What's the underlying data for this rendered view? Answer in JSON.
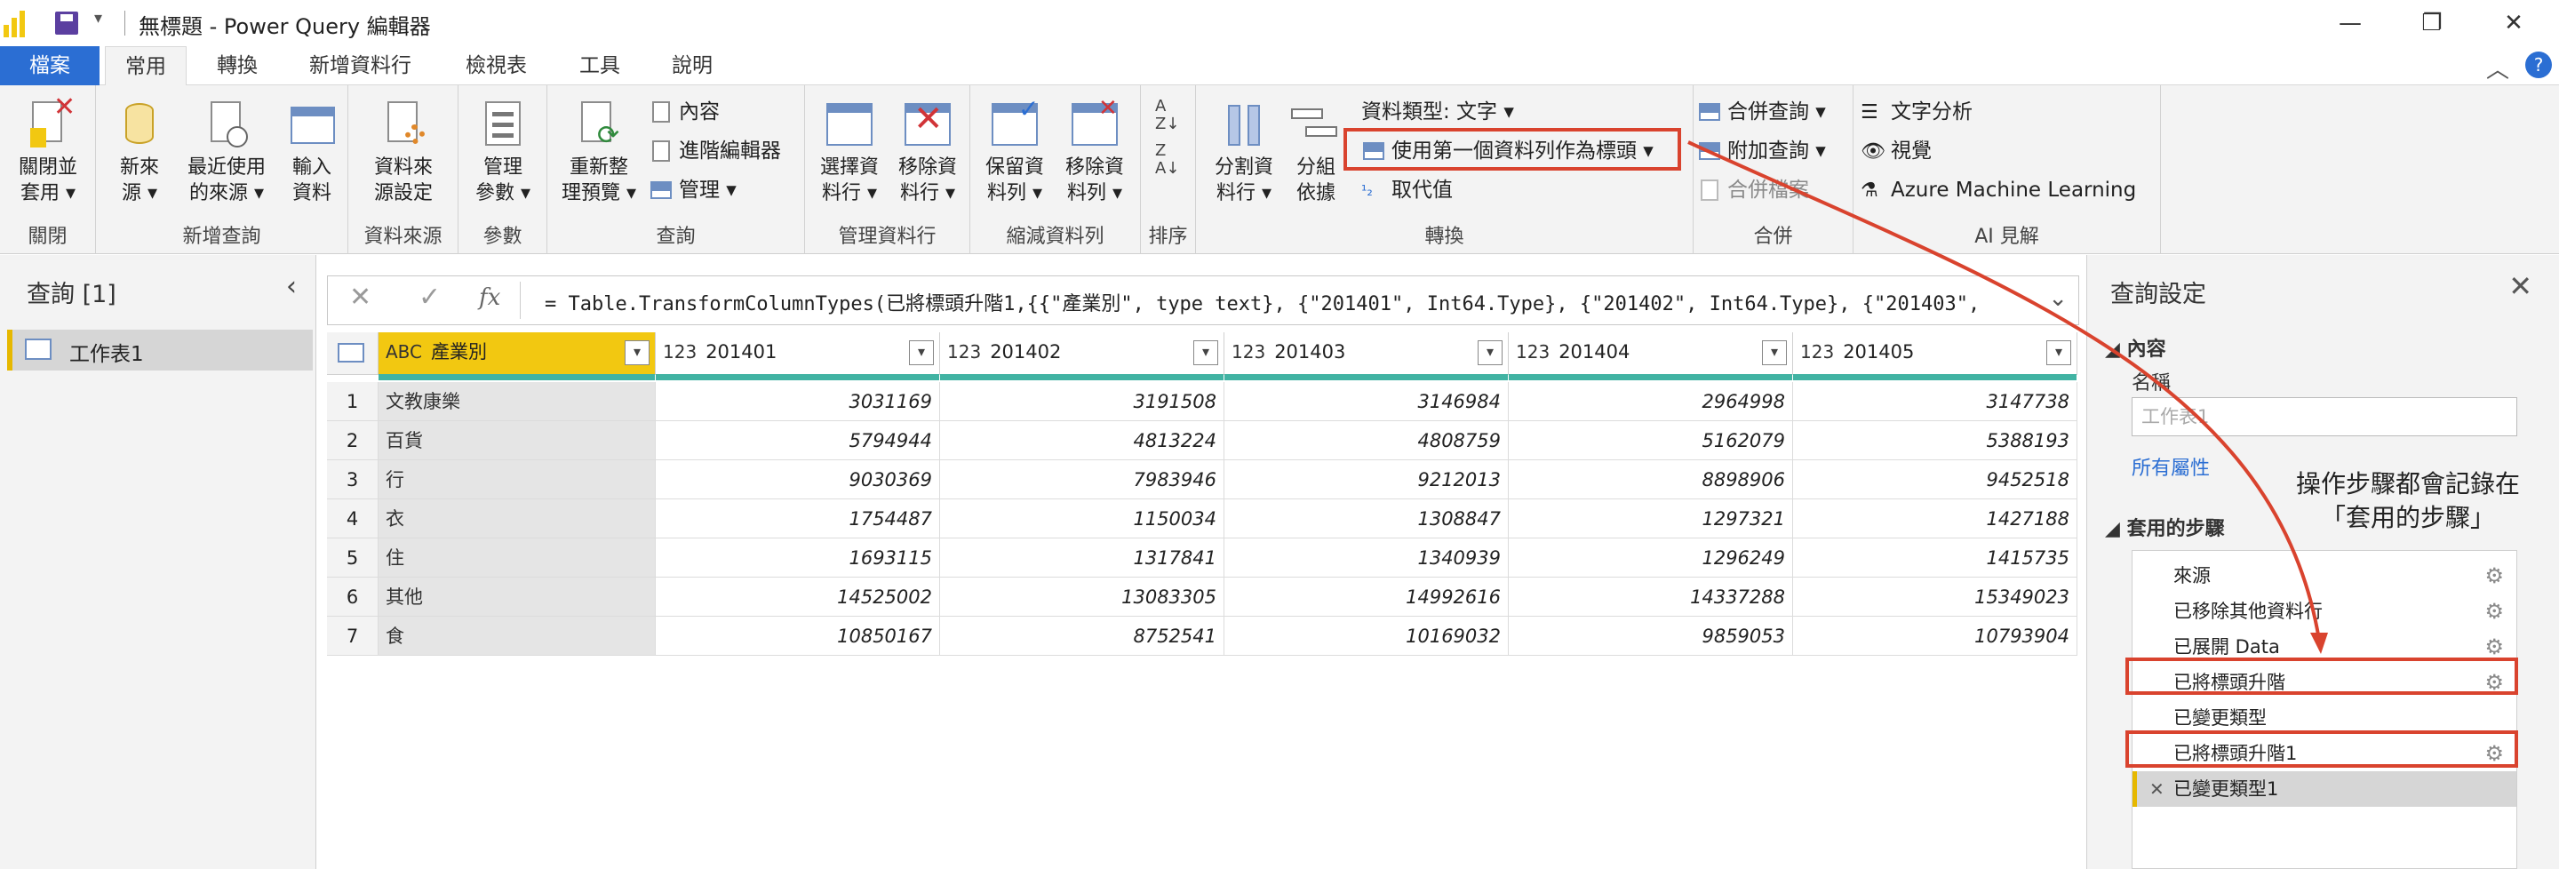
{
  "window": {
    "title": "無標題 - Power Query 編輯器",
    "minimize": "—",
    "restore": "❐",
    "close": "✕"
  },
  "menu": {
    "file": "檔案",
    "tabs": [
      "常用",
      "轉換",
      "新增資料行",
      "檢視表",
      "工具",
      "說明"
    ],
    "active_tab": "常用"
  },
  "ribbon": {
    "groups": {
      "close": "關閉",
      "new_query": "新增查詢",
      "data_source": "資料來源",
      "params": "參數",
      "query": "查詢",
      "manage_cols": "管理資料行",
      "reduce_rows": "縮減資料列",
      "sort": "排序",
      "transform": "轉換",
      "combine": "合併",
      "ai": "AI 見解"
    },
    "buttons": {
      "close_apply": [
        "關閉並",
        "套用 ▾"
      ],
      "new_source": [
        "新來",
        "源 ▾"
      ],
      "recent_sources": [
        "最近使用",
        "的來源 ▾"
      ],
      "enter_data": [
        "輸入",
        "資料"
      ],
      "data_source_settings": [
        "資料來",
        "源設定"
      ],
      "manage_params": [
        "管理",
        "參數 ▾"
      ],
      "refresh_preview": [
        "重新整",
        "理預覽 ▾"
      ],
      "properties": "內容",
      "advanced_editor": "進階編輯器",
      "manage": "管理 ▾",
      "choose_columns": [
        "選擇資",
        "料行 ▾"
      ],
      "remove_columns": [
        "移除資",
        "料行 ▾"
      ],
      "keep_rows": [
        "保留資",
        "料列 ▾"
      ],
      "remove_rows": [
        "移除資",
        "料列 ▾"
      ],
      "split_column": [
        "分割資",
        "料行 ▾"
      ],
      "group_by": [
        "分組",
        "依據"
      ],
      "data_type": "資料類型: 文字 ▾",
      "use_first_row_headers": "使用第一個資料列作為標頭 ▾",
      "replace_values": "取代值",
      "merge_queries": "合併查詢 ▾",
      "append_queries": "附加查詢 ▾",
      "combine_files": "合併檔案",
      "text_analytics": "文字分析",
      "vision": "視覺",
      "azure_ml": "Azure Machine Learning"
    }
  },
  "queries_pane": {
    "header": "查詢 [1]",
    "collapse": "‹",
    "items": [
      "工作表1"
    ]
  },
  "formula_bar": {
    "cancel": "✕",
    "commit": "✓",
    "fx": "fx",
    "formula": "= Table.TransformColumnTypes(已將標頭升階1,{{\"產業別\", type text}, {\"201401\", Int64.Type}, {\"201402\", Int64.Type}, {\"201403\",",
    "expand": "⌄"
  },
  "table": {
    "columns": [
      {
        "type": "ABC",
        "name": "產業別"
      },
      {
        "type": "123",
        "name": "201401"
      },
      {
        "type": "123",
        "name": "201402"
      },
      {
        "type": "123",
        "name": "201403"
      },
      {
        "type": "123",
        "name": "201404"
      },
      {
        "type": "123",
        "name": "201405"
      }
    ],
    "rows": [
      {
        "n": "1",
        "cat": "文教康樂",
        "v": [
          "3031169",
          "3191508",
          "3146984",
          "2964998",
          "3147738"
        ]
      },
      {
        "n": "2",
        "cat": "百貨",
        "v": [
          "5794944",
          "4813224",
          "4808759",
          "5162079",
          "5388193"
        ]
      },
      {
        "n": "3",
        "cat": "行",
        "v": [
          "9030369",
          "7983946",
          "9212013",
          "8898906",
          "9452518"
        ]
      },
      {
        "n": "4",
        "cat": "衣",
        "v": [
          "1754487",
          "1150034",
          "1308847",
          "1297321",
          "1427188"
        ]
      },
      {
        "n": "5",
        "cat": "住",
        "v": [
          "1693115",
          "1317841",
          "1340939",
          "1296249",
          "1415735"
        ]
      },
      {
        "n": "6",
        "cat": "其他",
        "v": [
          "14525002",
          "13083305",
          "14992616",
          "14337288",
          "15349023"
        ]
      },
      {
        "n": "7",
        "cat": "食",
        "v": [
          "10850167",
          "8752541",
          "10169032",
          "9859053",
          "10793904"
        ]
      }
    ]
  },
  "settings_pane": {
    "header": "查詢設定",
    "close": "✕",
    "properties_section": "◢ 內容",
    "name_label": "名稱",
    "name_value": "工作表1",
    "all_properties": "所有屬性",
    "steps_section": "◢ 套用的步驟",
    "steps": [
      {
        "label": "來源",
        "gear": true
      },
      {
        "label": "已移除其他資料行",
        "gear": true
      },
      {
        "label": "已展開 Data",
        "gear": true
      },
      {
        "label": "已將標頭升階",
        "gear": true
      },
      {
        "label": "已變更類型",
        "gear": false
      },
      {
        "label": "已將標頭升階1",
        "gear": true
      },
      {
        "label": "已變更類型1",
        "gear": false,
        "selected": true
      }
    ]
  },
  "annotation": {
    "line1": "操作步驟都會記錄在",
    "line2": "「套用的步驟」",
    "color": "#d9432e"
  }
}
